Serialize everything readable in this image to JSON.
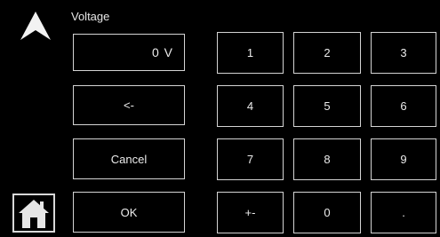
{
  "screen": {
    "title": "Voltage"
  },
  "display": {
    "value": "0 V"
  },
  "actions": {
    "backspace_label": "<-",
    "cancel_label": "Cancel",
    "ok_label": "OK"
  },
  "keypad": {
    "keys": [
      "1",
      "2",
      "3",
      "4",
      "5",
      "6",
      "7",
      "8",
      "9",
      "+-",
      "0",
      "."
    ]
  },
  "icons": {
    "up": "up-arrow-icon",
    "home": "home-icon"
  },
  "colors": {
    "background": "#000000",
    "border": "#d4d4d4",
    "text": "#ececec"
  }
}
